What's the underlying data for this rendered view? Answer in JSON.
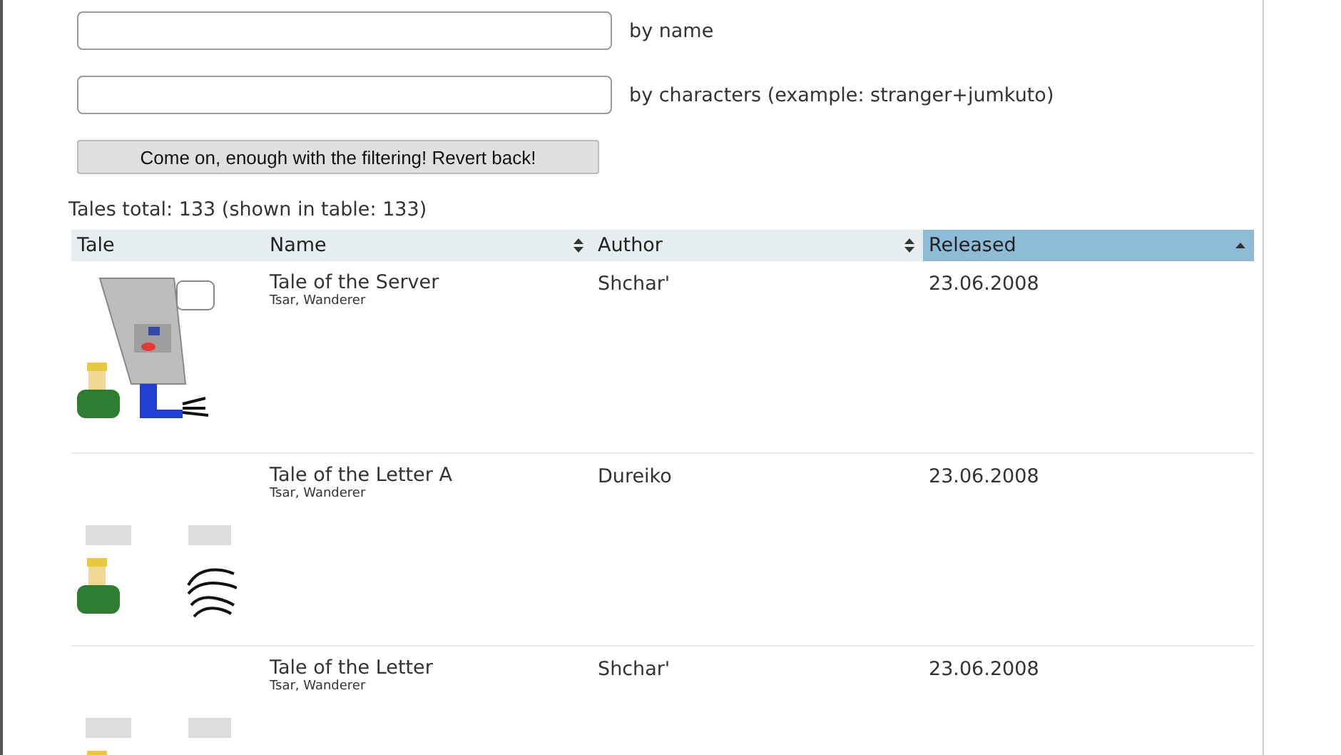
{
  "filters": [
    {
      "label": "by name"
    },
    {
      "label": "by characters (example: stranger+jumkuto)"
    }
  ],
  "revert_button": "Come on, enough with the filtering! Revert back!",
  "summary": "Tales total: 133 (shown in table: 133)",
  "table": {
    "columns": [
      {
        "label": "Tale",
        "sortable": false,
        "selected": false
      },
      {
        "label": "Name",
        "sortable": true,
        "selected": false
      },
      {
        "label": "Author",
        "sortable": true,
        "selected": false
      },
      {
        "label": "Released",
        "sortable": true,
        "selected": true
      }
    ],
    "rows": [
      {
        "kind": "server",
        "name": "Tale of the Server",
        "characters": "Tsar, Wanderer",
        "author": "Shchar'",
        "released": "23.06.2008"
      },
      {
        "kind": "letter",
        "name": "Tale of the Letter A",
        "characters": "Tsar, Wanderer",
        "author": "Dureiko",
        "released": "23.06.2008"
      },
      {
        "kind": "letter",
        "name": "Tale of the Letter",
        "characters": "Tsar, Wanderer",
        "author": "Shchar'",
        "released": "23.06.2008"
      }
    ]
  }
}
